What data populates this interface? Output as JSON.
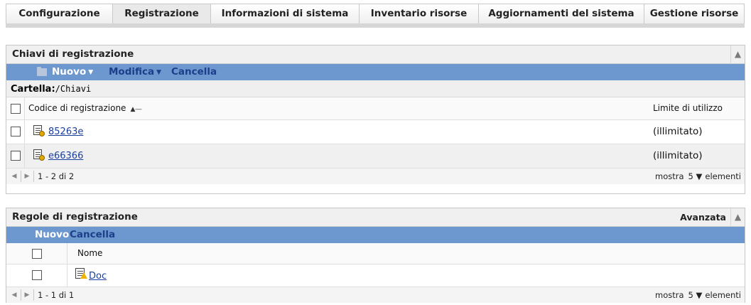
{
  "tabs": [
    {
      "label": "Configurazione"
    },
    {
      "label": "Registrazione"
    },
    {
      "label": "Informazioni di sistema"
    },
    {
      "label": "Inventario risorse"
    },
    {
      "label": "Aggiornamenti del sistema"
    },
    {
      "label": "Gestione risorse"
    }
  ],
  "active_tab": "Registrazione",
  "keys_panel": {
    "title": "Chiavi di registrazione",
    "toolbar": {
      "new_label": "Nuovo",
      "edit_label": "Modifica",
      "delete_label": "Cancella"
    },
    "folder_label": "Cartella:",
    "folder_path": "/Chiavi",
    "columns": {
      "code": "Codice di registrazione",
      "limit": "Limite di utilizzo"
    },
    "rows": [
      {
        "code": "85263e",
        "limit": "(illimitato)"
      },
      {
        "code": "e66366",
        "limit": "(illimitato)"
      }
    ],
    "pager": {
      "range": "1 - 2 di 2",
      "show_prefix": "mostra",
      "count": "5",
      "show_suffix": "elementi"
    }
  },
  "rules_panel": {
    "title": "Regole di registrazione",
    "advanced_label": "Avanzata",
    "toolbar": {
      "new_label": "Nuovo",
      "delete_label": "Cancella"
    },
    "columns": {
      "name": "Nome"
    },
    "rows": [
      {
        "name": "Doc"
      }
    ],
    "pager": {
      "range": "1 - 1 di 1",
      "show_prefix": "mostra",
      "count": "5",
      "show_suffix": "elementi"
    }
  },
  "colors": {
    "toolbar_bg": "#6c97cf",
    "link": "#1b3f9c"
  },
  "icons": [
    "folder-icon",
    "key-icon",
    "rule-icon",
    "collapse-icon",
    "sort-ascending-icon",
    "caret-down-icon",
    "prev-page-icon",
    "next-page-icon"
  ]
}
